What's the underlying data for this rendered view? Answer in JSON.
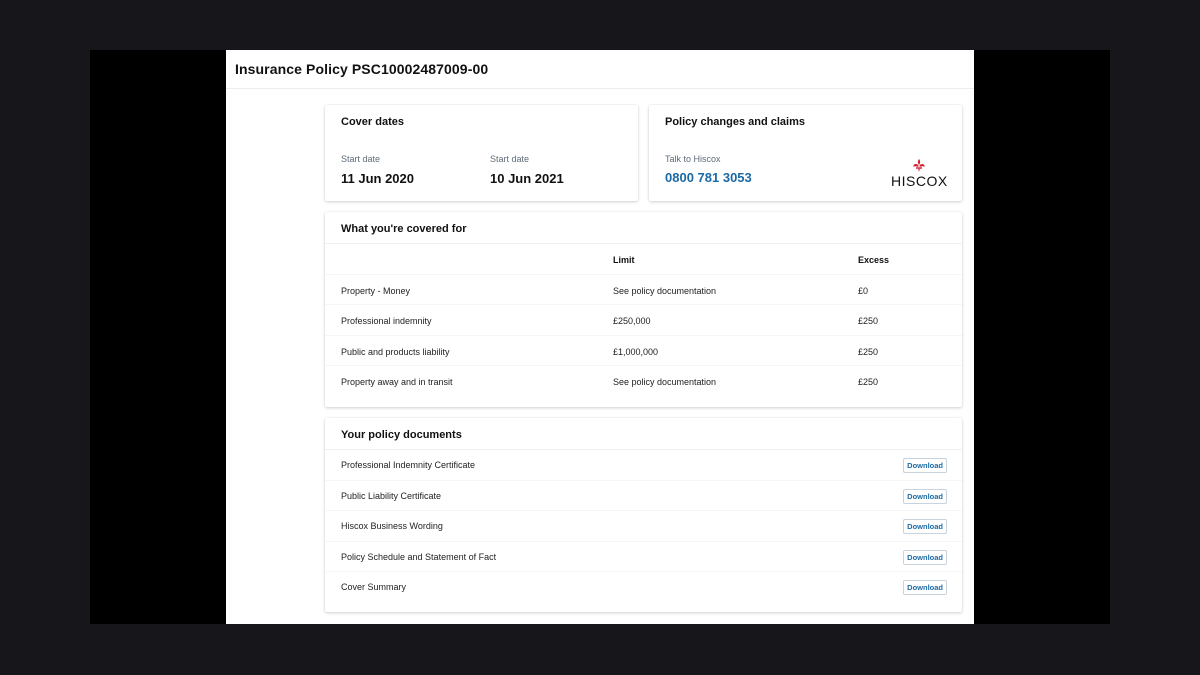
{
  "header": {
    "title": "Insurance Policy PSC10002487009-00"
  },
  "cover_dates": {
    "title": "Cover dates",
    "start_label": "Start date",
    "start_value": "11 Jun 2020",
    "end_label": "Start date",
    "end_value": "10 Jun 2021"
  },
  "claims": {
    "title": "Policy changes and claims",
    "talk_label": "Talk to Hiscox",
    "phone": "0800 781 3053",
    "logo_text": "HISCOX"
  },
  "coverage": {
    "title": "What you're covered for",
    "headers": [
      "",
      "Limit",
      "Excess"
    ],
    "rows": [
      [
        "Property - Money",
        "See policy documentation",
        "£0"
      ],
      [
        "Professional indemnity",
        "£250,000",
        "£250"
      ],
      [
        "Public and products liability",
        "£1,000,000",
        "£250"
      ],
      [
        "Property away and in transit",
        "See policy documentation",
        "£250"
      ]
    ]
  },
  "documents": {
    "title": "Your policy documents",
    "download_label": "Download",
    "items": [
      "Professional Indemnity Certificate",
      "Public Liability Certificate",
      "Hiscox Business Wording",
      "Policy Schedule and Statement of Fact",
      "Cover Summary"
    ]
  },
  "colors": {
    "accent": "#1b6aa5",
    "logo_red": "#d3202f",
    "backdrop": "#16161b"
  }
}
